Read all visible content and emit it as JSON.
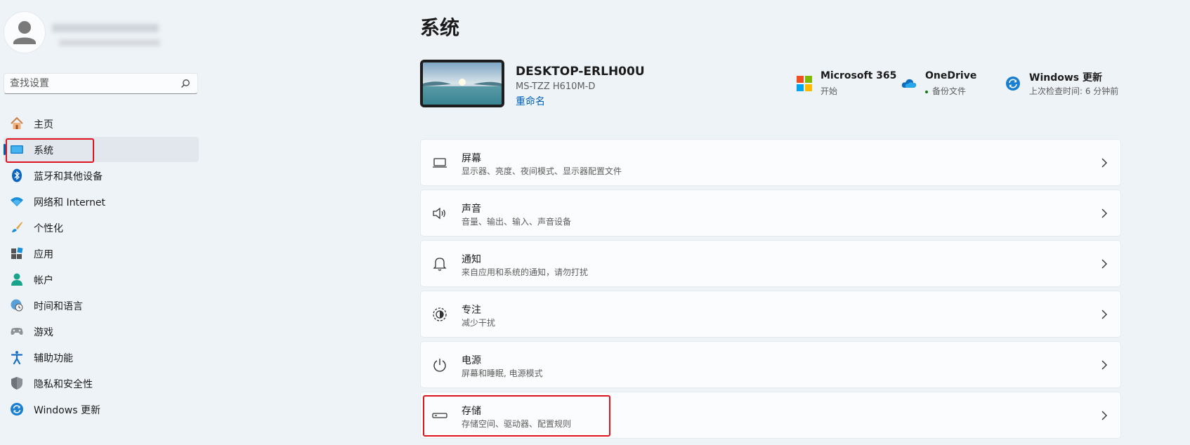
{
  "sidebar": {
    "search": {
      "placeholder": "查找设置"
    },
    "items": [
      {
        "label": "主页",
        "icon": "home-icon"
      },
      {
        "label": "系统",
        "icon": "system-display-icon",
        "selected": true
      },
      {
        "label": "蓝牙和其他设备",
        "icon": "bluetooth-icon"
      },
      {
        "label": "网络和 Internet",
        "icon": "wifi-icon"
      },
      {
        "label": "个性化",
        "icon": "brush-icon"
      },
      {
        "label": "应用",
        "icon": "apps-icon"
      },
      {
        "label": "帐户",
        "icon": "account-icon"
      },
      {
        "label": "时间和语言",
        "icon": "time-language-icon"
      },
      {
        "label": "游戏",
        "icon": "gamepad-icon"
      },
      {
        "label": "辅助功能",
        "icon": "accessibility-icon"
      },
      {
        "label": "隐私和安全性",
        "icon": "shield-icon"
      },
      {
        "label": "Windows 更新",
        "icon": "windows-update-icon"
      }
    ]
  },
  "main": {
    "title": "系统",
    "device": {
      "name": "DESKTOP-ERLH00U",
      "model": "MS-TZZ H610M-D",
      "rename": "重命名"
    },
    "quick_links": [
      {
        "title": "Microsoft 365",
        "subtitle": "开始",
        "icon": "microsoft-365-icon"
      },
      {
        "title": "OneDrive",
        "subtitle": "备份文件",
        "icon": "onedrive-icon",
        "status_color": "#0f7b0f"
      },
      {
        "title": "Windows 更新",
        "subtitle": "上次检查时间: 6 分钟前",
        "icon": "windows-update-icon"
      }
    ],
    "cards": [
      {
        "title": "屏幕",
        "subtitle": "显示器、亮度、夜间模式、显示器配置文件",
        "icon": "monitor-icon"
      },
      {
        "title": "声音",
        "subtitle": "音量、输出、输入、声音设备",
        "icon": "speaker-icon"
      },
      {
        "title": "通知",
        "subtitle": "来自应用和系统的通知，请勿打扰",
        "icon": "bell-icon"
      },
      {
        "title": "专注",
        "subtitle": "减少干扰",
        "icon": "focus-icon"
      },
      {
        "title": "电源",
        "subtitle": "屏幕和睡眠, 电源模式",
        "icon": "power-icon"
      },
      {
        "title": "存储",
        "subtitle": "存储空间、驱动器、配置规则",
        "icon": "storage-icon"
      }
    ]
  },
  "colors": {
    "accent": "#005fb8",
    "highlight": "#e0141e"
  }
}
